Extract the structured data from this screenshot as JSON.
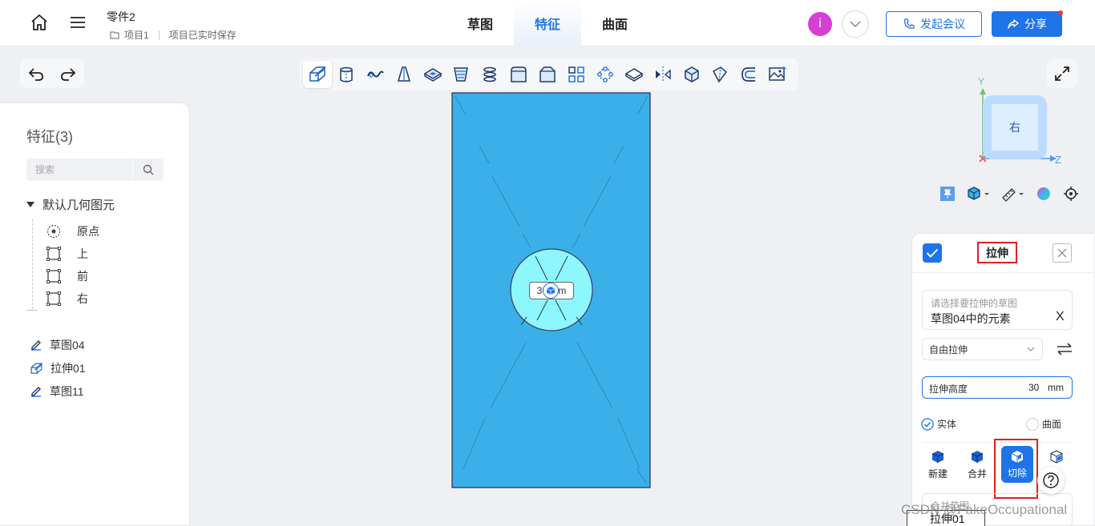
{
  "header": {
    "doc_title": "零件2",
    "project": "项目1",
    "save_status": "项目已实时保存",
    "tabs": [
      {
        "label": "草图",
        "active": false
      },
      {
        "label": "特征",
        "active": true
      },
      {
        "label": "曲面",
        "active": false
      }
    ],
    "avatar_letter": "i",
    "meeting_button": "发起会议",
    "share_button": "分享",
    "accent_color": "#1e74e8"
  },
  "toolbar": {
    "tools": [
      "extrude-icon",
      "revolve-icon",
      "sweep-icon",
      "loft-icon",
      "shell-icon",
      "draft-icon",
      "thread-icon",
      "fillet-icon",
      "chamfer-icon",
      "pattern-icon",
      "circular-pattern-icon",
      "face-icon",
      "mirror-icon",
      "transform-icon",
      "split-icon",
      "offset-icon",
      "image-icon"
    ],
    "active_index": 0
  },
  "left_panel": {
    "title": "特征(3)",
    "search_placeholder": "搜索",
    "default_group": "默认几何图元",
    "default_items": [
      "原点",
      "上",
      "前",
      "右"
    ],
    "features": [
      {
        "label": "草图04",
        "icon": "sketch-icon"
      },
      {
        "label": "拉伸01",
        "icon": "extrude-icon"
      },
      {
        "label": "草图11",
        "icon": "sketch-icon"
      }
    ]
  },
  "viewport": {
    "dimension_text": "30 mm",
    "body_color": "#3bb0e8",
    "circle_color": "#8ef7fb"
  },
  "view_cube": {
    "face_label": "右",
    "axis_y": "Y",
    "axis_z": "Z"
  },
  "extrude_panel": {
    "title": "拉伸",
    "sketch_hint": "请选择要拉伸的草图",
    "sketch_value": "草图04中的元素",
    "clear_label": "X",
    "mode": "自由拉伸",
    "height_label": "拉伸高度",
    "height_value": "30",
    "height_unit": "mm",
    "type_solid": "实体",
    "type_surface": "曲面",
    "op_new": "新建",
    "op_merge": "合并",
    "op_cut": "切除",
    "range_hint": "合并范围",
    "range_value": "拉伸01"
  },
  "watermark": "CSDN @FakeOccupational"
}
